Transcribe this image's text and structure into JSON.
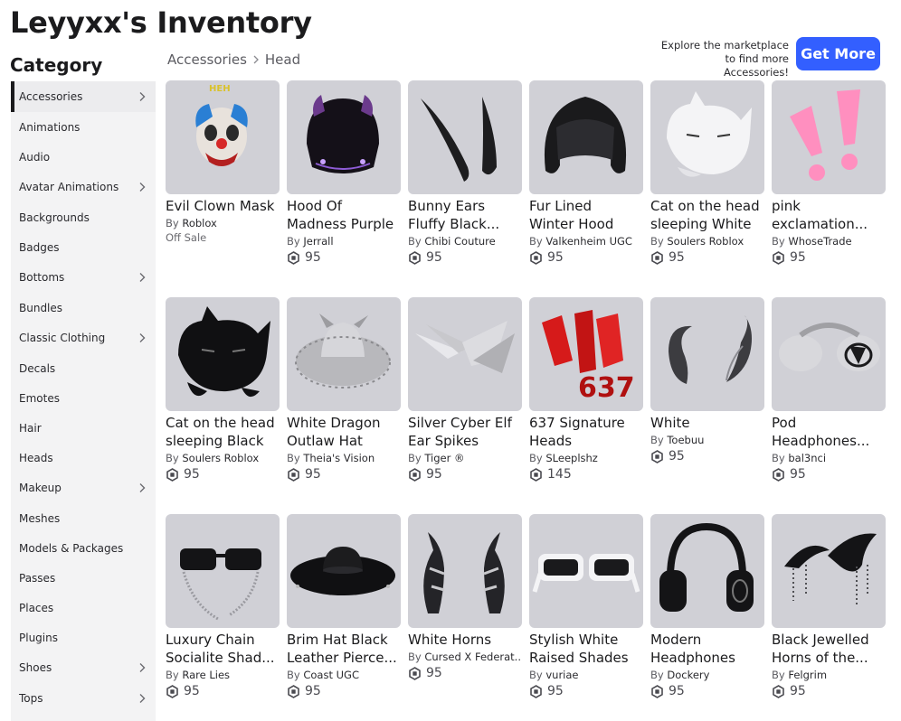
{
  "page": {
    "title": "Leyyxx's Inventory"
  },
  "sidebar": {
    "title": "Category",
    "items": [
      {
        "label": "Accessories",
        "chevron": true,
        "active": true
      },
      {
        "label": "Animations",
        "chevron": false
      },
      {
        "label": "Audio",
        "chevron": false
      },
      {
        "label": "Avatar Animations",
        "chevron": true
      },
      {
        "label": "Backgrounds",
        "chevron": false
      },
      {
        "label": "Badges",
        "chevron": false
      },
      {
        "label": "Bottoms",
        "chevron": true
      },
      {
        "label": "Bundles",
        "chevron": false
      },
      {
        "label": "Classic Clothing",
        "chevron": true
      },
      {
        "label": "Decals",
        "chevron": false
      },
      {
        "label": "Emotes",
        "chevron": false
      },
      {
        "label": "Hair",
        "chevron": false
      },
      {
        "label": "Heads",
        "chevron": false
      },
      {
        "label": "Makeup",
        "chevron": true
      },
      {
        "label": "Meshes",
        "chevron": false
      },
      {
        "label": "Models & Packages",
        "chevron": false
      },
      {
        "label": "Passes",
        "chevron": false
      },
      {
        "label": "Places",
        "chevron": false
      },
      {
        "label": "Plugins",
        "chevron": false
      },
      {
        "label": "Shoes",
        "chevron": true
      },
      {
        "label": "Tops",
        "chevron": true
      }
    ]
  },
  "breadcrumb": {
    "parent": "Accessories",
    "current": "Head"
  },
  "marketplace": {
    "line1": "Explore the marketplace",
    "line2": "to find more Accessories!",
    "button": "Get More"
  },
  "by_label": "By",
  "items": [
    {
      "name1": "Evil Clown Mask",
      "name2": "",
      "creator": "Roblox",
      "offsale": "Off Sale",
      "icon": "clown-mask-icon"
    },
    {
      "name1": "Hood Of",
      "name2": "Madness Purple",
      "creator": "Jerrall",
      "price": "95",
      "icon": "hood-icon"
    },
    {
      "name1": "Bunny Ears",
      "name2": "Fluffy Black...",
      "creator": "Chibi Couture",
      "price": "95",
      "icon": "bunny-ears-icon"
    },
    {
      "name1": "Fur Lined",
      "name2": "Winter Hood",
      "creator": "Valkenheim UGC",
      "price": "95",
      "icon": "fur-hood-icon"
    },
    {
      "name1": "Cat on the head",
      "name2": "sleeping White",
      "creator": "Soulers Roblox",
      "price": "95",
      "icon": "white-cat-icon"
    },
    {
      "name1": "pink",
      "name2": "exclamation...",
      "creator": "WhoseTrade",
      "price": "95",
      "icon": "exclamation-icon"
    },
    {
      "name1": "Cat on the head",
      "name2": "sleeping Black",
      "creator": "Soulers Roblox",
      "price": "95",
      "icon": "black-cat-icon"
    },
    {
      "name1": "White Dragon",
      "name2": "Outlaw Hat",
      "creator": "Theia's Vision",
      "price": "95",
      "icon": "dragon-hat-icon"
    },
    {
      "name1": "Silver Cyber Elf",
      "name2": "Ear Spikes",
      "creator": "Tiger ®",
      "price": "95",
      "icon": "elf-spikes-icon"
    },
    {
      "name1": "637 Signature",
      "name2": "Heads",
      "creator": "SLeeplshz",
      "price": "145",
      "icon": "red-signature-icon"
    },
    {
      "name1": "White",
      "name2": "",
      "creator": "Toebuu",
      "price": "95",
      "icon": "horns-icon"
    },
    {
      "name1": "Pod",
      "name2": "Headphones...",
      "creator": "bal3nci",
      "price": "95",
      "icon": "pod-headphones-icon"
    },
    {
      "name1": "Luxury Chain",
      "name2": "Socialite Shad...",
      "creator": "Rare Lies",
      "price": "95",
      "icon": "chain-shades-icon"
    },
    {
      "name1": "Brim Hat Black",
      "name2": "Leather Pierce...",
      "creator": "Coast UGC",
      "price": "95",
      "icon": "brim-hat-icon"
    },
    {
      "name1": "White Horns",
      "name2": "",
      "creator": "Cursed X Federat...",
      "price": "95",
      "icon": "white-horns-icon"
    },
    {
      "name1": "Stylish White",
      "name2": "Raised Shades",
      "creator": "vuriae",
      "price": "95",
      "icon": "white-shades-icon"
    },
    {
      "name1": "Modern",
      "name2": "Headphones",
      "creator": "Dockery",
      "price": "95",
      "icon": "headphones-icon"
    },
    {
      "name1": "Black Jewelled",
      "name2": "Horns of the...",
      "creator": "Felgrim",
      "price": "95",
      "icon": "jewelled-horns-icon"
    }
  ],
  "colors": {
    "accent": "#335fff",
    "thumb_bg": "#d0d0d6",
    "sidebar_bg": "#f3f3f4"
  }
}
